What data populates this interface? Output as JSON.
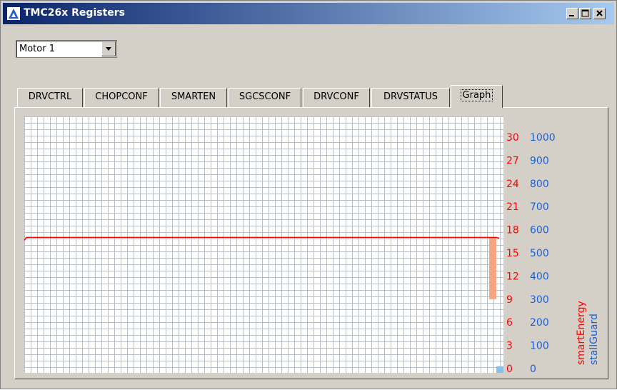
{
  "window": {
    "title": "TMC26x Registers"
  },
  "controls": {
    "minimize": "minimize",
    "maximize": "maximize",
    "close": "close"
  },
  "motor_select": {
    "value": "Motor 1"
  },
  "tabs": [
    "DRVCTRL",
    "CHOPCONF",
    "SMARTEN",
    "SGCSCONF",
    "DRVCONF",
    "DRVSTATUS",
    "Graph"
  ],
  "active_tab": "Graph",
  "colors": {
    "smartEnergy": "#ff0000",
    "stallGuard": "#1a5fd6",
    "bar": "#f4a582",
    "stallBar": "#87c3e8",
    "grid": "#b8bec8"
  },
  "chart_data": {
    "type": "line",
    "series": [
      {
        "name": "smartEnergy",
        "axis": "left",
        "ylim": [
          0,
          30
        ],
        "ticks": [
          0,
          3,
          6,
          9,
          12,
          15,
          18,
          21,
          24,
          27,
          30
        ],
        "line_value": 17,
        "bar_range": [
          9,
          17
        ]
      },
      {
        "name": "stallGuard",
        "axis": "right",
        "ylim": [
          0,
          1000
        ],
        "ticks": [
          0,
          100,
          200,
          300,
          400,
          500,
          600,
          700,
          800,
          900,
          1000
        ],
        "bar_range": [
          0,
          10
        ]
      }
    ],
    "axis_labels": [
      "smartEnergy",
      "stallGuard"
    ],
    "grid": true
  }
}
